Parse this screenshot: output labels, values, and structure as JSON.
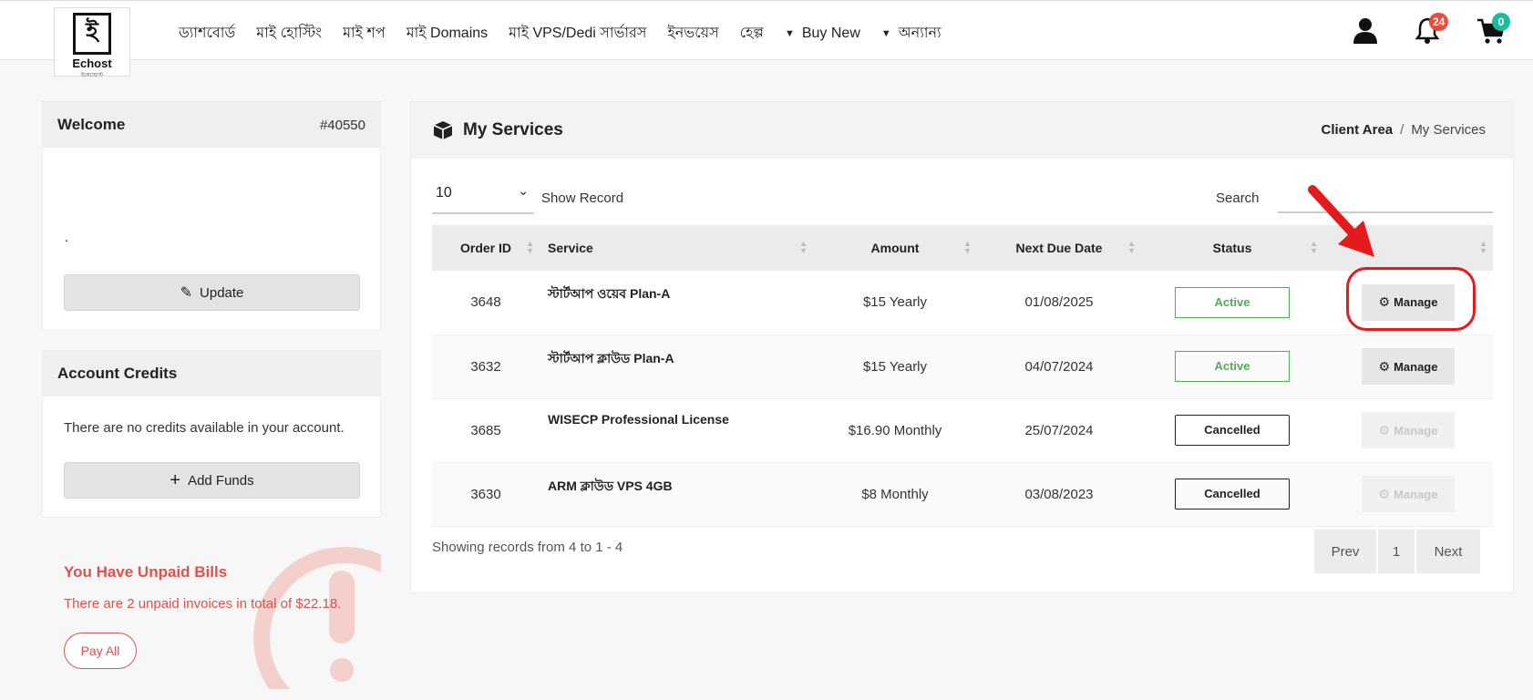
{
  "brand": {
    "name": "Echost",
    "tagline": "ইকোহোস্ট",
    "mark": "ই"
  },
  "nav": [
    "ড্যাশবোর্ড",
    "মাই হোস্টিং",
    "মাই শপ",
    "মাই Domains",
    "মাই VPS/Dedi সার্ভারস",
    "ইনভয়েস",
    "হেল্প",
    "Buy New",
    "অন্যান্য"
  ],
  "header": {
    "notifications": "24",
    "cart_count": "0"
  },
  "welcome": {
    "title": "Welcome",
    "client_id": "#40550",
    "body": ".",
    "update_label": "Update"
  },
  "credits": {
    "title": "Account Credits",
    "text": "There are no credits available in your account.",
    "add_label": "Add Funds"
  },
  "unpaid": {
    "title": "You Have Unpaid Bills",
    "text": "There are 2 unpaid invoices in total of $22.18.",
    "pay_label": "Pay All"
  },
  "main": {
    "title": "My Services",
    "breadcrumb": {
      "root": "Client Area",
      "sep": "/",
      "current": "My Services"
    },
    "page_size": "10",
    "show_record": "Show Record",
    "search_label": "Search",
    "search_value": "",
    "columns": [
      "Order ID",
      "Service",
      "Amount",
      "Next Due Date",
      "Status",
      ""
    ],
    "rows": [
      {
        "id": "3648",
        "service": "স্টার্টআপ ওয়েব Plan-A",
        "amount": "$15 Yearly",
        "due": "01/08/2025",
        "status": "Active",
        "manage": "Manage"
      },
      {
        "id": "3632",
        "service": "স্টার্টআপ ক্লাউড Plan-A",
        "amount": "$15 Yearly",
        "due": "04/07/2024",
        "status": "Active",
        "manage": "Manage"
      },
      {
        "id": "3685",
        "service": "WISECP Professional License",
        "amount": "$16.90 Monthly",
        "due": "25/07/2024",
        "status": "Cancelled",
        "manage": "Manage"
      },
      {
        "id": "3630",
        "service": "ARM ক্লাউড VPS 4GB",
        "amount": "$8 Monthly",
        "due": "03/08/2023",
        "status": "Cancelled",
        "manage": "Manage"
      }
    ],
    "showing": "Showing records from 4 to 1 - 4",
    "pager": {
      "prev": "Prev",
      "page": "1",
      "next": "Next"
    }
  },
  "colors": {
    "accent_red": "#d9534f",
    "active_green": "#4caf50",
    "annotation_red": "#e31b1b"
  }
}
